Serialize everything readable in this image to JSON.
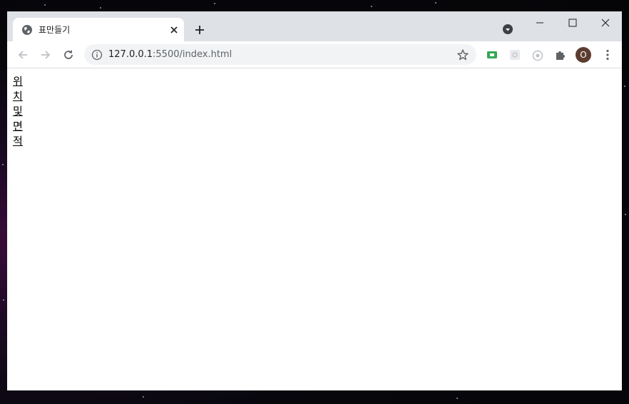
{
  "browser": {
    "tab": {
      "title": "표만들기",
      "favicon": "globe-icon"
    },
    "address": {
      "host": "127.0.0.1",
      "rest": ":5500/index.html"
    },
    "profile_initial": "O"
  },
  "page": {
    "vertical_text": "위치및면적"
  },
  "colors": {
    "titlebar": "#dee1e6",
    "omnibox": "#f1f3f4",
    "avatar": "#5d3c30",
    "extension_green": "#34a853"
  }
}
